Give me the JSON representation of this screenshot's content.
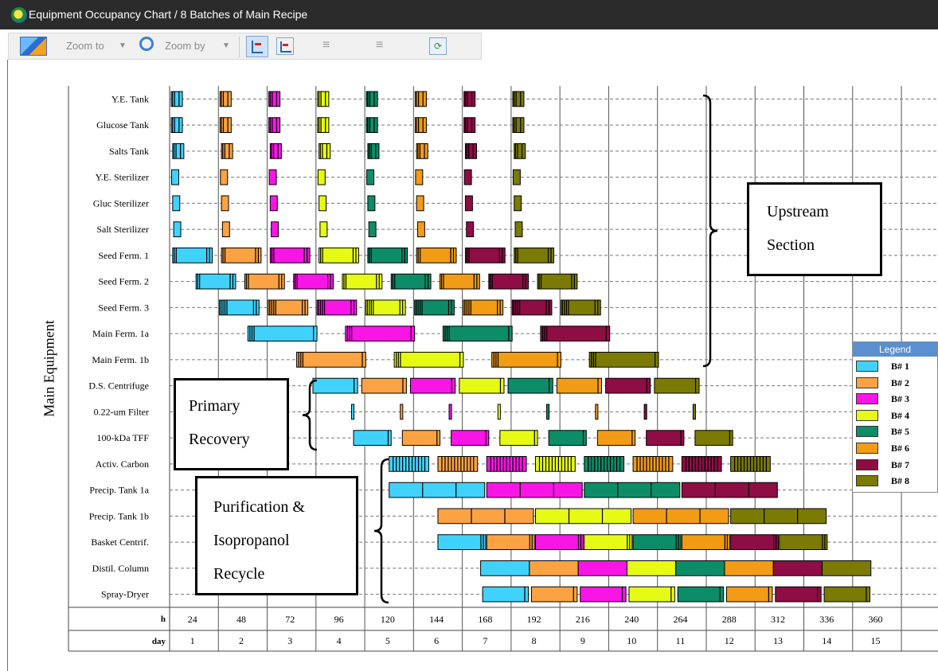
{
  "window": {
    "title": "Equipment Occupancy Chart /  8 Batches of Main Recipe"
  },
  "toolbar": {
    "zoom_to_label": "Zoom to",
    "zoom_by_label": "Zoom by"
  },
  "y_axis_title": "Main Equipment",
  "colors": {
    "B1": "#40d2fa",
    "B2": "#fba242",
    "B3": "#f815e6",
    "B4": "#e6fb14",
    "B5": "#0c8d68",
    "B6": "#f29b15",
    "B7": "#8e0d45",
    "B8": "#7a7a05"
  },
  "legend": {
    "title": "Legend",
    "items": [
      {
        "label": "B# 1",
        "color": "#40d2fa"
      },
      {
        "label": "B# 2",
        "color": "#fba242"
      },
      {
        "label": "B# 3",
        "color": "#f815e6"
      },
      {
        "label": "B# 4",
        "color": "#e6fb14"
      },
      {
        "label": "B# 5",
        "color": "#0c8d68"
      },
      {
        "label": "B# 6",
        "color": "#f29b15"
      },
      {
        "label": "B# 7",
        "color": "#8e0d45"
      },
      {
        "label": "B# 8",
        "color": "#7a7a05"
      }
    ]
  },
  "annotations": {
    "upstream_line1": "Upstream",
    "upstream_line2": "Section",
    "primary_line1": "Primary",
    "primary_line2": "Recovery",
    "purification_line1": "Purification &",
    "purification_line2": "Isopropanol",
    "purification_line3": "Recycle"
  },
  "chart_data": {
    "type": "gantt",
    "x_unit_label": "h",
    "day_label": "day",
    "x_range_h": [
      0,
      378
    ],
    "ticks_h": [
      24,
      48,
      72,
      96,
      120,
      144,
      168,
      192,
      216,
      240,
      264,
      288,
      312,
      336,
      360
    ],
    "ticks_day": [
      1,
      2,
      3,
      4,
      5,
      6,
      7,
      8,
      9,
      10,
      11,
      12,
      13,
      14,
      15
    ],
    "grid": "vertical solid at ticks, dashed horizontal per equipment row",
    "equipment": [
      "Y.E. Tank",
      "Glucose Tank",
      "Salts Tank",
      "Y.E. Sterilizer",
      "Gluc Sterilizer",
      "Salt Sterilizer",
      "Seed Ferm. 1",
      "Seed Ferm. 2",
      "Seed Ferm. 3",
      "Main Ferm. 1a",
      "Main Ferm. 1b",
      "D.S. Centrifuge",
      "0.22-um Filter",
      "100-kDa TFF",
      "Activ. Carbon",
      "Precip. Tank 1a",
      "Precip. Tank 1b",
      "Basket Centrif.",
      "Distil. Column",
      "Spray-Dryer"
    ],
    "schedule": [
      {
        "equipment": "Y.E. Tank",
        "first_start": 0.8,
        "duration": 5.5,
        "cycle": 24,
        "batches": [
          1,
          2,
          3,
          4,
          5,
          6,
          7,
          8
        ],
        "dividers": [
          0.12,
          0.3,
          0.7
        ]
      },
      {
        "equipment": "Glucose Tank",
        "first_start": 0.8,
        "duration": 5.5,
        "cycle": 24,
        "batches": [
          1,
          2,
          3,
          4,
          5,
          6,
          7,
          8
        ],
        "dividers": [
          0.12,
          0.3,
          0.7
        ]
      },
      {
        "equipment": "Salts Tank",
        "first_start": 1.5,
        "duration": 5.5,
        "cycle": 24,
        "batches": [
          1,
          2,
          3,
          4,
          5,
          6,
          7,
          8
        ],
        "dividers": [
          0.12,
          0.3,
          0.7
        ]
      },
      {
        "equipment": "Y.E. Sterilizer",
        "first_start": 1.0,
        "duration": 3.5,
        "cycle": 24,
        "batches": [
          1,
          2,
          3,
          4,
          5,
          6,
          7,
          8
        ]
      },
      {
        "equipment": "Gluc Sterilizer",
        "first_start": 1.5,
        "duration": 3.5,
        "cycle": 24,
        "batches": [
          1,
          2,
          3,
          4,
          5,
          6,
          7,
          8
        ]
      },
      {
        "equipment": "Salt Sterilizer",
        "first_start": 2.0,
        "duration": 3.5,
        "cycle": 24,
        "batches": [
          1,
          2,
          3,
          4,
          5,
          6,
          7,
          8
        ]
      },
      {
        "equipment": "Seed Ferm. 1",
        "first_start": 1.5,
        "duration": 19.5,
        "cycle": 24,
        "batches": [
          1,
          2,
          3,
          4,
          5,
          6,
          7,
          8
        ],
        "dividers": [
          0.04,
          0.09,
          0.86,
          0.93
        ]
      },
      {
        "equipment": "Seed Ferm. 2",
        "first_start": 13,
        "duration": 19.5,
        "cycle": 24,
        "batches": [
          1,
          2,
          3,
          4,
          5,
          6,
          7,
          8
        ],
        "dividers": [
          0.04,
          0.09,
          0.86,
          0.93
        ]
      },
      {
        "equipment": "Seed Ferm. 3",
        "first_start": 24.5,
        "duration": 19.5,
        "cycle": 24,
        "batches": [
          1,
          2,
          3,
          4,
          5,
          6,
          7,
          8
        ],
        "dividers": [
          0.04,
          0.09,
          0.14,
          0.19,
          0.86,
          0.93
        ]
      },
      {
        "equipment": "Main Ferm. 1a",
        "first_start": 38.5,
        "duration": 34,
        "cycle": 48,
        "batches": [
          1,
          3,
          5,
          7
        ],
        "dividers": [
          0.03,
          0.06,
          0.09,
          0.95
        ]
      },
      {
        "equipment": "Main Ferm. 1b",
        "first_start": 62.5,
        "duration": 34,
        "cycle": 48,
        "batches": [
          2,
          4,
          6,
          8
        ],
        "dividers": [
          0.03,
          0.06,
          0.09,
          0.95
        ]
      },
      {
        "equipment": "D.S. Centrifuge",
        "first_start": 70.5,
        "duration": 22,
        "cycle": 24,
        "batches": [
          1,
          2,
          3,
          4,
          5,
          6,
          7,
          8
        ],
        "dividers": [
          0.92
        ]
      },
      {
        "equipment": "0.22-um Filter",
        "first_start": 89.5,
        "duration": 1.2,
        "cycle": 24,
        "batches": [
          1,
          2,
          3,
          4,
          5,
          6,
          7,
          8
        ]
      },
      {
        "equipment": "100-kDa TFF",
        "first_start": 90.5,
        "duration": 18.5,
        "cycle": 24,
        "batches": [
          1,
          2,
          3,
          4,
          5,
          6,
          7,
          8
        ],
        "dividers": [
          0.92
        ]
      },
      {
        "equipment": "Activ. Carbon",
        "first_start": 108,
        "duration": 19.5,
        "cycle": 24,
        "batches": [
          1,
          2,
          3,
          4,
          5,
          6,
          7,
          8
        ],
        "dividers": [
          0.1,
          0.18,
          0.26,
          0.34,
          0.42,
          0.5,
          0.58,
          0.66,
          0.74,
          0.82,
          0.9
        ]
      },
      {
        "equipment": "Precip. Tank 1a",
        "first_start": 108,
        "duration": 47,
        "cycle": 48,
        "batches": [
          1,
          3,
          5,
          7
        ],
        "dividers": [
          0.35,
          0.7
        ]
      },
      {
        "equipment": "Precip. Tank 1b",
        "first_start": 132,
        "duration": 47,
        "cycle": 48,
        "batches": [
          2,
          4,
          6,
          8
        ],
        "dividers": [
          0.35,
          0.7
        ]
      },
      {
        "equipment": "Basket Centrif.",
        "first_start": 132,
        "duration": 23.5,
        "cycle": 24,
        "batches": [
          1,
          2,
          3,
          4,
          5,
          6,
          7,
          8
        ],
        "dividers": [
          0.9,
          0.95
        ]
      },
      {
        "equipment": "Distil. Column",
        "first_start": 153,
        "duration": 24,
        "cycle": 24,
        "batches": [
          1,
          2,
          3,
          4,
          5,
          6,
          7,
          8
        ]
      },
      {
        "equipment": "Spray-Dryer",
        "first_start": 154,
        "duration": 22.5,
        "cycle": 24,
        "batches": [
          1,
          2,
          3,
          4,
          5,
          6,
          7,
          8
        ],
        "dividers": [
          0.92
        ]
      }
    ]
  }
}
